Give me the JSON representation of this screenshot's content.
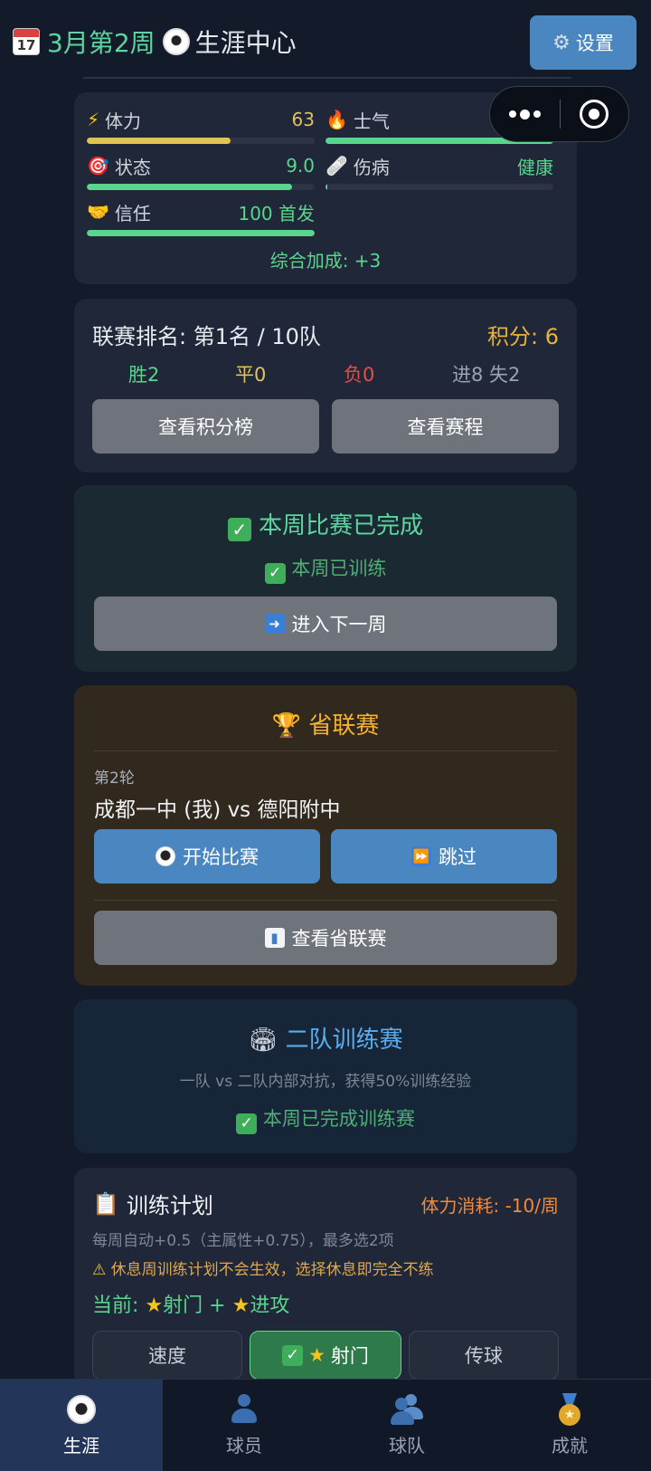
{
  "header": {
    "calendar_day": "17",
    "week": "3月第2周",
    "center": "生涯中心",
    "settings_label": "设置"
  },
  "stats": {
    "stamina": {
      "label": "体力",
      "value": "63",
      "level": 0.63,
      "color": "#e0c452"
    },
    "morale": {
      "label": "士气",
      "value": "100",
      "level": 1.0,
      "color": "#58d68d"
    },
    "form": {
      "label": "状态",
      "value": "9.0",
      "level": 0.9,
      "color": "#58d68d"
    },
    "injury": {
      "label": "伤病",
      "value": "健康",
      "level": 0.0,
      "color": "#58d68d"
    },
    "trust": {
      "label": "信任",
      "value": "100 首发",
      "level": 1.0,
      "color": "#58d68d"
    },
    "bonus": "综合加成: +3"
  },
  "league": {
    "rank": "联赛排名: 第1名 / 10队",
    "points": "积分: 6",
    "wins": "胜2",
    "draws": "平0",
    "losses": "负0",
    "goals": "进8 失2",
    "standings_button": "查看积分榜",
    "schedule_button": "查看赛程"
  },
  "week_status": {
    "title": "本周比赛已完成",
    "trained": "本周已训练",
    "next_week_button": "进入下一周"
  },
  "provincial": {
    "title": "省联赛",
    "round": "第2轮",
    "match": "成都一中 (我) vs 德阳附中",
    "start_button": "开始比赛",
    "skip_button": "跳过",
    "view_button": "查看省联赛"
  },
  "reserve": {
    "title": "二队训练赛",
    "desc": "一队 vs 二队内部对抗，获得50%训练经验",
    "status": "本周已完成训练赛"
  },
  "training": {
    "title": "训练计划",
    "cost": "体力消耗: -10/周",
    "note": "每周自动+0.5（主属性+0.75），最多选2项",
    "warning": "休息周训练计划不会生效，选择休息即完全不练",
    "current_label": "当前:",
    "current_item1": "射门",
    "current_plus": "+",
    "current_item2": "进攻",
    "options": [
      "速度",
      "射门",
      "传球"
    ]
  },
  "tabs": [
    "生涯",
    "球员",
    "球队",
    "成就"
  ]
}
